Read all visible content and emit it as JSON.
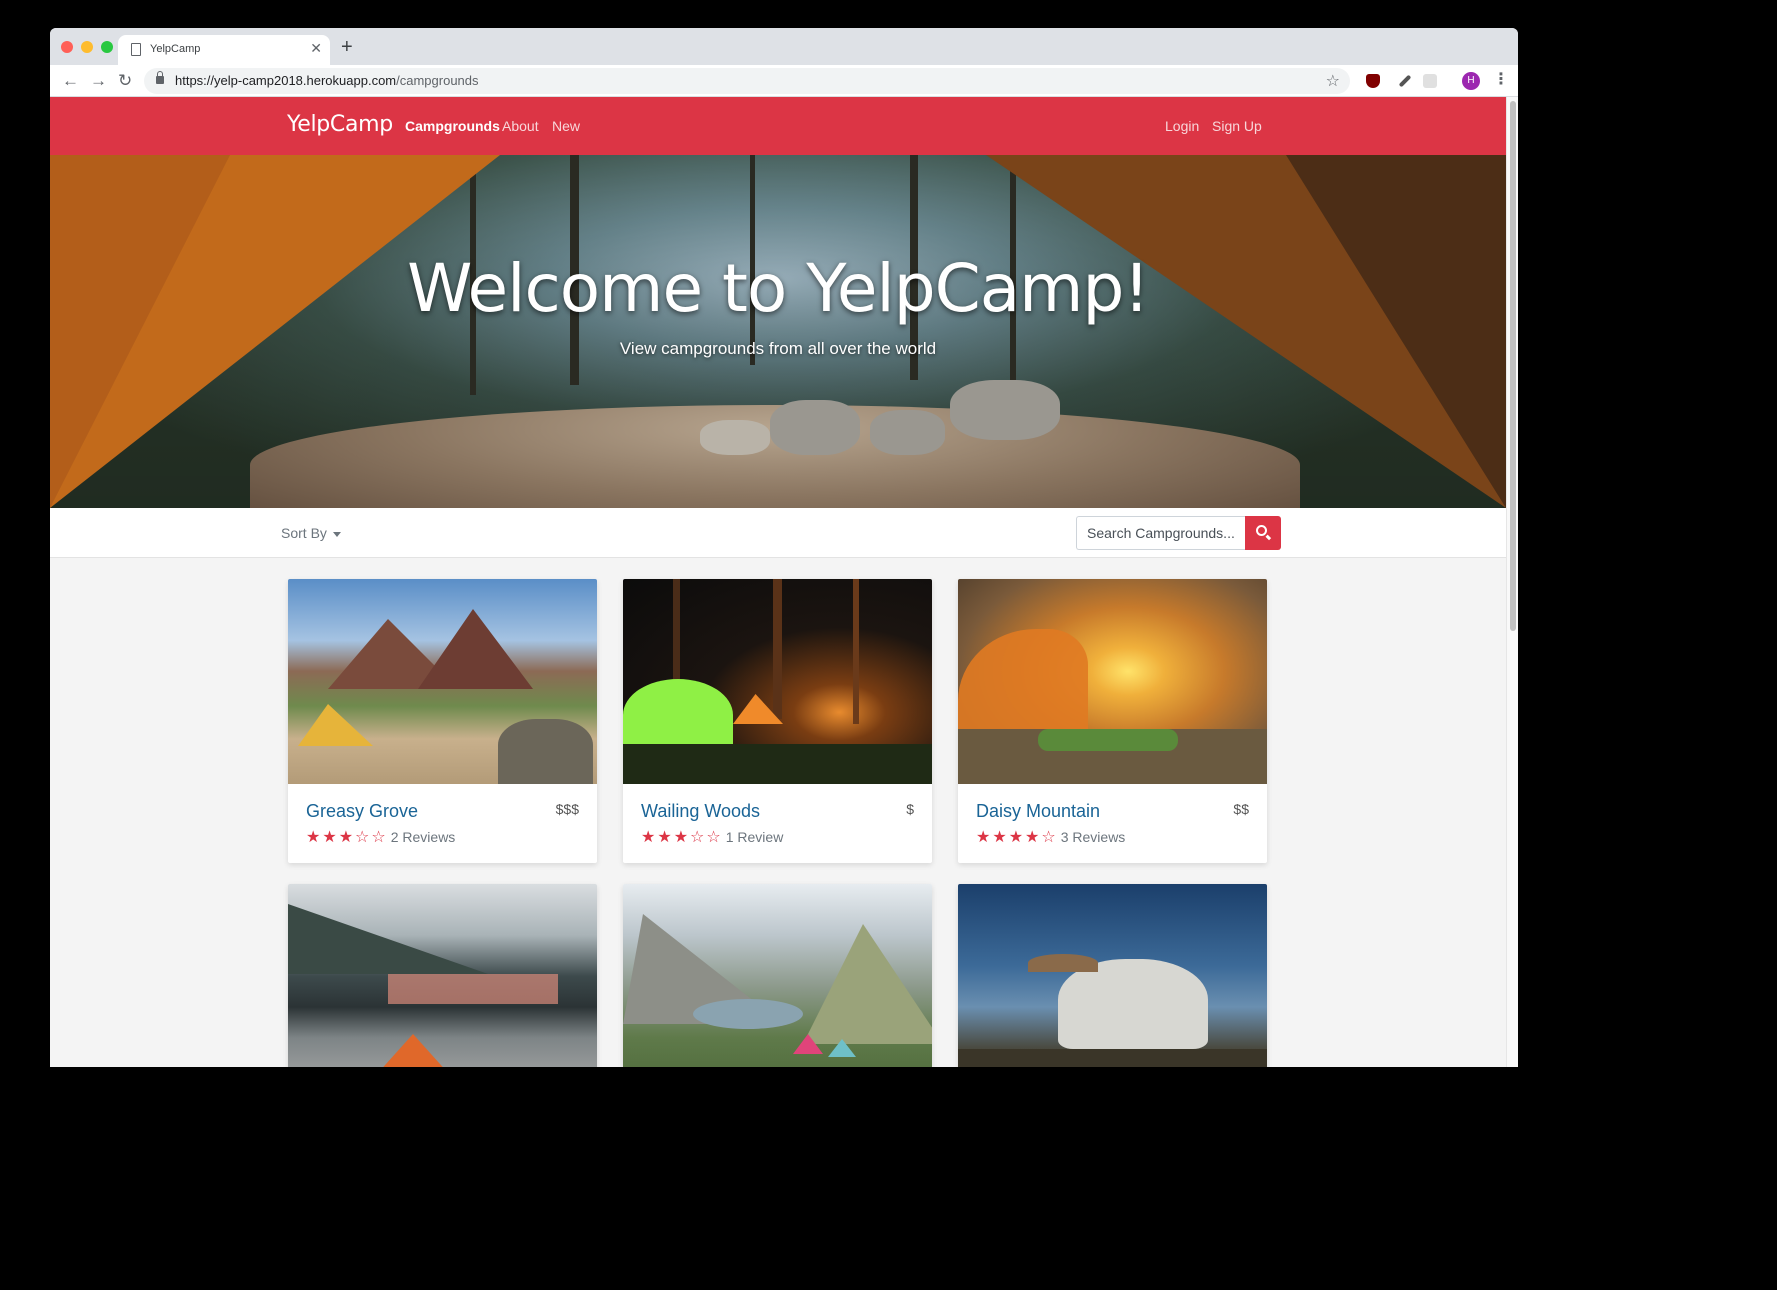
{
  "browser": {
    "tab_title": "YelpCamp",
    "url_host": "https://yelp-camp2018.herokuapp.com",
    "url_path": "/campgrounds",
    "avatar_letter": "H"
  },
  "navbar": {
    "brand": "YelpCamp",
    "links": [
      "Campgrounds",
      "About",
      "New"
    ],
    "active": "Campgrounds",
    "right_links": [
      "Login",
      "Sign Up"
    ],
    "color": "#dc3545"
  },
  "hero": {
    "title": "Welcome to YelpCamp!",
    "subtitle": "View campgrounds from all over the world"
  },
  "filter": {
    "sort_label": "Sort By",
    "search_placeholder": "Search Campgrounds..."
  },
  "campgrounds": [
    {
      "name": "Greasy Grove",
      "price": "$$$",
      "rating": 3,
      "reviews": "2 Reviews"
    },
    {
      "name": "Wailing Woods",
      "price": "$",
      "rating": 3,
      "reviews": "1 Review"
    },
    {
      "name": "Daisy Mountain",
      "price": "$$",
      "rating": 4,
      "reviews": "3 Reviews"
    }
  ]
}
